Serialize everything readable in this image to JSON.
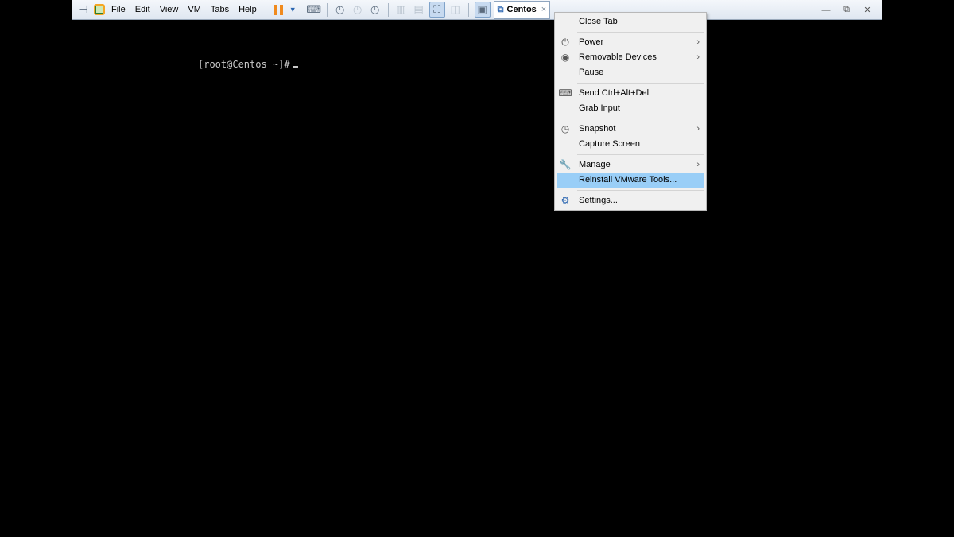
{
  "toolbar": {
    "menus": [
      "File",
      "Edit",
      "View",
      "VM",
      "Tabs",
      "Help"
    ],
    "tab_title": "Centos",
    "tab_close": "×"
  },
  "window_controls": {
    "minimize": "—",
    "restore": "⧉",
    "close": "✕"
  },
  "console": {
    "prompt": "[root@Centos ~]#"
  },
  "context_menu": {
    "items": [
      {
        "label": "Close Tab",
        "icon": "",
        "submenu": false
      },
      {
        "label": "Power",
        "icon": "power-icon",
        "submenu": true
      },
      {
        "label": "Removable Devices",
        "icon": "disc-icon",
        "submenu": true
      },
      {
        "label": "Pause",
        "icon": "",
        "submenu": false
      },
      {
        "label": "Send Ctrl+Alt+Del",
        "icon": "keyboard-icon",
        "submenu": false
      },
      {
        "label": "Grab Input",
        "icon": "",
        "submenu": false
      },
      {
        "label": "Snapshot",
        "icon": "snapshot-icon",
        "submenu": true
      },
      {
        "label": "Capture Screen",
        "icon": "",
        "submenu": false
      },
      {
        "label": "Manage",
        "icon": "wrench-icon",
        "submenu": true
      },
      {
        "label": "Reinstall VMware Tools...",
        "icon": "",
        "submenu": false,
        "highlighted": true
      },
      {
        "label": "Settings...",
        "icon": "settings-icon",
        "submenu": false
      }
    ],
    "submenu_arrow": "›"
  },
  "colors": {
    "highlight": "#99cef7",
    "pause": "#f08a1d",
    "toolbar_bg": "#e6edf6"
  }
}
